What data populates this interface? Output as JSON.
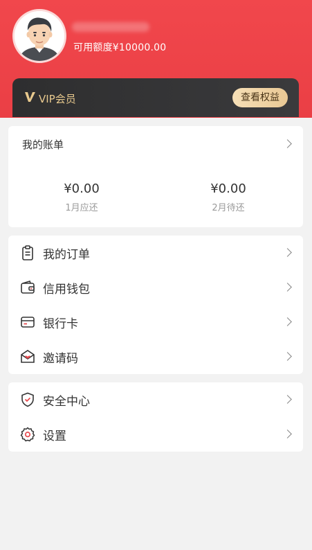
{
  "profile": {
    "credit_text": "可用额度¥10000.00"
  },
  "vip": {
    "label": "VIP会员",
    "button": "查看权益"
  },
  "bill": {
    "title": "我的账单",
    "items": [
      {
        "amount": "¥0.00",
        "label": "1月应还"
      },
      {
        "amount": "¥0.00",
        "label": "2月待还"
      }
    ]
  },
  "menu": {
    "items": [
      {
        "label": "我的订单",
        "icon": "clipboard-icon"
      },
      {
        "label": "信用钱包",
        "icon": "wallet-icon"
      },
      {
        "label": "银行卡",
        "icon": "bank-card-icon"
      },
      {
        "label": "邀请码",
        "icon": "envelope-heart-icon"
      }
    ]
  },
  "menu2": {
    "items": [
      {
        "label": "安全中心",
        "icon": "shield-check-icon"
      },
      {
        "label": "设置",
        "icon": "gear-icon"
      }
    ]
  },
  "colors": {
    "header": "#ee4449",
    "vip_gold": "#e8c98e",
    "vip_dark": "#333335"
  }
}
